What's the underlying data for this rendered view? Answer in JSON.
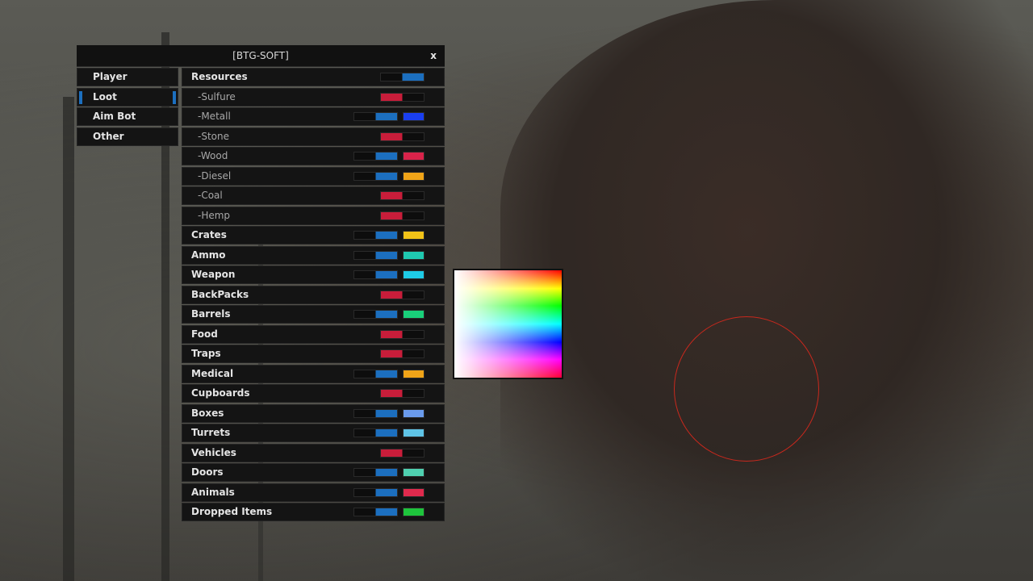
{
  "window": {
    "title": "[BTG-SOFT]",
    "close_label": "x"
  },
  "tabs": [
    {
      "label": "Player",
      "active": false
    },
    {
      "label": "Loot",
      "active": true
    },
    {
      "label": "Aim Bot",
      "active": false
    },
    {
      "label": "Other",
      "active": false
    }
  ],
  "colors": {
    "accent_blue": "#1c6fbf",
    "toggle_off_red": "#c81d3a"
  },
  "loot_items": [
    {
      "label": "Resources",
      "kind": "main",
      "toggle": "on",
      "color": null
    },
    {
      "label": "-Sulfure",
      "kind": "sub",
      "toggle": "off",
      "color": null
    },
    {
      "label": "-Metall",
      "kind": "sub",
      "toggle": "on",
      "color": "#1a3ff0"
    },
    {
      "label": "-Stone",
      "kind": "sub",
      "toggle": "off",
      "color": null
    },
    {
      "label": "-Wood",
      "kind": "sub",
      "toggle": "on",
      "color": "#d8234a"
    },
    {
      "label": "-Diesel",
      "kind": "sub",
      "toggle": "on",
      "color": "#f0a418"
    },
    {
      "label": "-Coal",
      "kind": "sub",
      "toggle": "off",
      "color": null
    },
    {
      "label": "-Hemp",
      "kind": "sub",
      "toggle": "off",
      "color": null
    },
    {
      "label": "Crates",
      "kind": "main",
      "toggle": "on",
      "color": "#f2c318"
    },
    {
      "label": "Ammo",
      "kind": "main",
      "toggle": "on",
      "color": "#1fc9b0"
    },
    {
      "label": "Weapon",
      "kind": "main",
      "toggle": "on",
      "color": "#1ecbe6"
    },
    {
      "label": "BackPacks",
      "kind": "main",
      "toggle": "off",
      "color": null
    },
    {
      "label": "Barrels",
      "kind": "main",
      "toggle": "on",
      "color": "#19d07a"
    },
    {
      "label": "Food",
      "kind": "main",
      "toggle": "off",
      "color": null
    },
    {
      "label": "Traps",
      "kind": "main",
      "toggle": "off",
      "color": null
    },
    {
      "label": "Medical",
      "kind": "main",
      "toggle": "on",
      "color": "#f0a418"
    },
    {
      "label": "Cupboards",
      "kind": "main",
      "toggle": "off",
      "color": null
    },
    {
      "label": "Boxes",
      "kind": "main",
      "toggle": "on",
      "color": "#6a9bec"
    },
    {
      "label": "Turrets",
      "kind": "main",
      "toggle": "on",
      "color": "#5fc4e6"
    },
    {
      "label": "Vehicles",
      "kind": "main",
      "toggle": "off",
      "color": null
    },
    {
      "label": "Doors",
      "kind": "main",
      "toggle": "on",
      "color": "#4fd0b0"
    },
    {
      "label": "Animals",
      "kind": "main",
      "toggle": "on",
      "color": "#e02a4d"
    },
    {
      "label": "Dropped Items",
      "kind": "main",
      "toggle": "on",
      "color": "#1ec43c"
    }
  ]
}
